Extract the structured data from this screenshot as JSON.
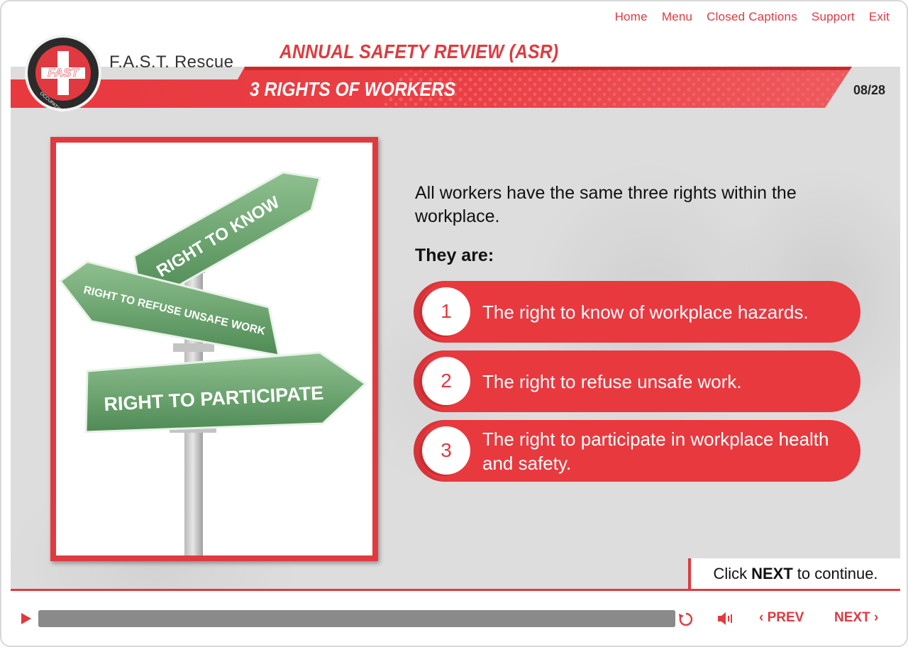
{
  "nav": {
    "items": [
      "Home",
      "Menu",
      "Closed Captions",
      "Support",
      "Exit"
    ]
  },
  "brand": {
    "logo_text": "FAST",
    "logo_ring_text": "OCCUPATIONAL HEALTH & SAFETY",
    "name": "F.A.S.T. Rescue"
  },
  "header": {
    "title": "ANNUAL SAFETY REVIEW (ASR)",
    "subtitle": "3 RIGHTS OF WORKERS",
    "page_counter": "08/28"
  },
  "signs": {
    "top": "RIGHT TO KNOW",
    "middle": "RIGHT TO REFUSE UNSAFE WORK",
    "bottom": "RIGHT TO PARTICIPATE"
  },
  "content": {
    "intro": "All workers have the same three rights within the workplace.",
    "they_are": "They are:",
    "rights": [
      {
        "number": "1",
        "text": "The right to know of workplace hazards."
      },
      {
        "number": "2",
        "text": "The right to refuse unsafe work."
      },
      {
        "number": "3",
        "text": "The right to participate in workplace health and safety."
      }
    ]
  },
  "continue": {
    "prefix": "Click",
    "emphasis": "NEXT",
    "suffix": "to continue."
  },
  "player": {
    "prev_label": "PREV",
    "next_label": "NEXT",
    "progress_fraction": 1.0
  },
  "colors": {
    "accent": "#e03a40",
    "sign_green": "#6fa672"
  },
  "icons": {
    "play": "play-icon",
    "replay": "replay-icon",
    "volume": "volume-icon",
    "prev": "chevron-left-icon",
    "next": "chevron-right-icon"
  }
}
